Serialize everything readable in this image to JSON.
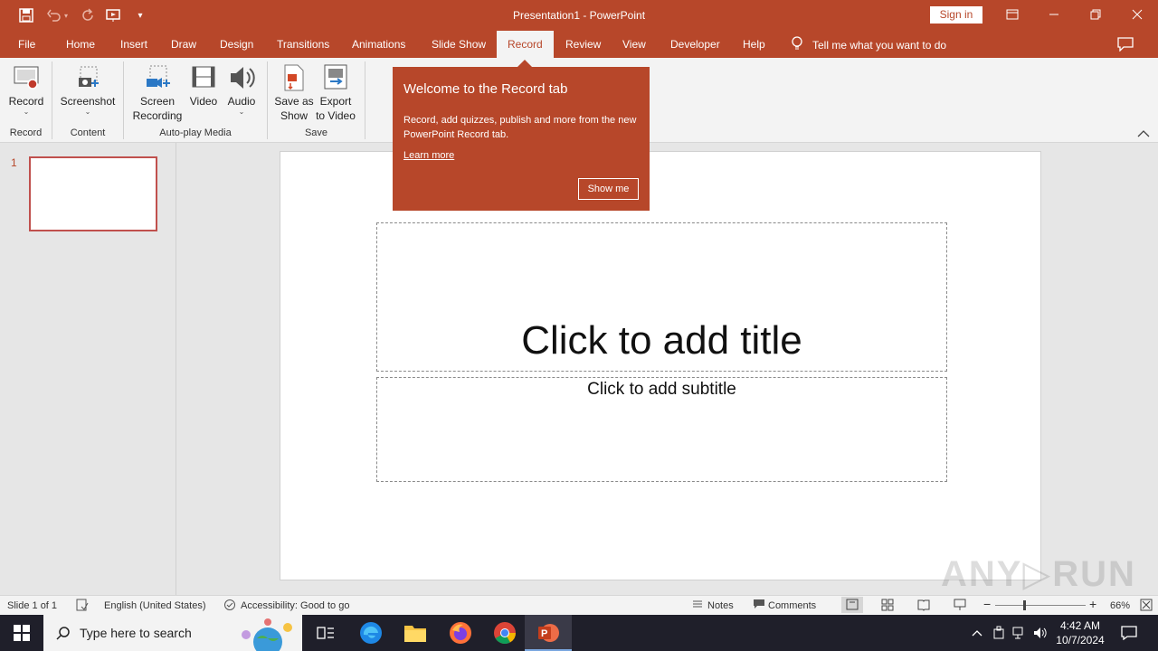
{
  "window": {
    "title": "Presentation1  -  PowerPoint",
    "sign_in": "Sign in"
  },
  "tabs": [
    "File",
    "Home",
    "Insert",
    "Draw",
    "Design",
    "Transitions",
    "Animations",
    "Slide Show",
    "Record",
    "Review",
    "View",
    "Developer",
    "Help"
  ],
  "active_tab": "Record",
  "tell_me": "Tell me what you want to do",
  "ribbon": {
    "record": {
      "label": "Record",
      "group": "Record"
    },
    "screenshot": {
      "label": "Screenshot",
      "group": "Content"
    },
    "screen_recording": {
      "line1": "Screen",
      "line2": "Recording"
    },
    "video": {
      "label": "Video"
    },
    "audio": {
      "label": "Audio"
    },
    "autoplay_group": "Auto-play Media",
    "save_as_show": {
      "line1": "Save as",
      "line2": "Show"
    },
    "export_to_video": {
      "line1": "Export",
      "line2": "to Video"
    },
    "save_group": "Save"
  },
  "popup": {
    "title": "Welcome to the Record tab",
    "body": "Record, add quizzes, publish and more from the new PowerPoint Record tab.",
    "learn_more": "Learn more",
    "show_me": "Show me"
  },
  "slides_pane": {
    "number": "1"
  },
  "slide": {
    "title_placeholder": "Click to add title",
    "subtitle_placeholder": "Click to add subtitle"
  },
  "status": {
    "slide_count": "Slide 1 of 1",
    "language": "English (United States)",
    "accessibility": "Accessibility: Good to go",
    "notes": "Notes",
    "comments": "Comments",
    "zoom": "66%"
  },
  "taskbar": {
    "search_placeholder": "Type here to search",
    "time": "4:42 AM",
    "date": "10/7/2024"
  },
  "watermark": "ANY RUN",
  "colors": {
    "accent": "#b7472a",
    "ribbon_bg": "#f3f3f3",
    "taskbar_bg": "#1f1f2a"
  }
}
